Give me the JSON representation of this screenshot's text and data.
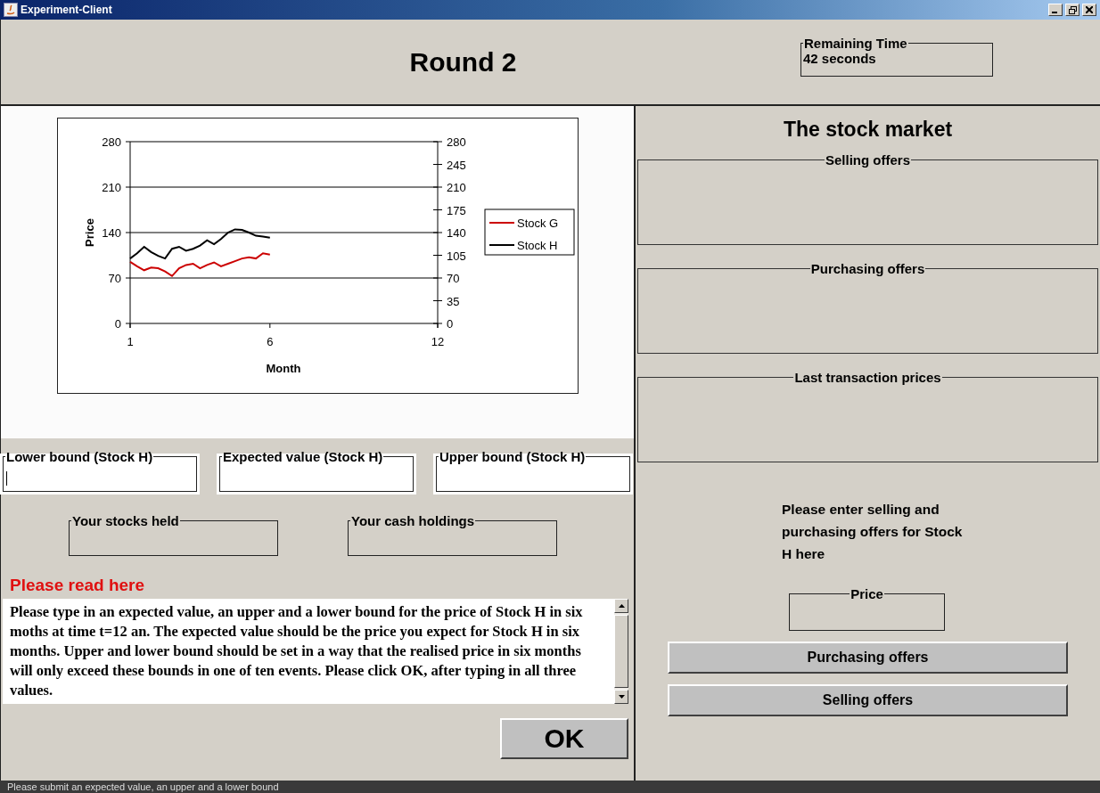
{
  "window": {
    "title": "Experiment-Client"
  },
  "header": {
    "round_title": "Round 2",
    "remaining_time": {
      "label": "Remaining Time",
      "value": "42 seconds"
    }
  },
  "chart": {
    "right_axis_ticks": [
      "280",
      "245",
      "210",
      "175",
      "140",
      "105",
      "70",
      "35",
      "0"
    ],
    "chart_data": {
      "type": "line",
      "xlabel": "Month",
      "ylabel": "Price",
      "x": [
        1,
        1.25,
        1.5,
        1.75,
        2,
        2.25,
        2.5,
        2.75,
        3,
        3.25,
        3.5,
        3.75,
        4,
        4.25,
        4.5,
        4.75,
        5,
        5.25,
        5.5,
        5.75,
        6
      ],
      "xlim": [
        1,
        12
      ],
      "ylim": [
        0,
        280
      ],
      "xticks": [
        {
          "value": 1,
          "label": "1"
        },
        {
          "value": 6,
          "label": "6"
        },
        {
          "value": 12,
          "label": "12"
        }
      ],
      "yticks": [
        {
          "value": 0,
          "label": "0"
        },
        {
          "value": 70,
          "label": "70"
        },
        {
          "value": 140,
          "label": "140"
        },
        {
          "value": 210,
          "label": "210"
        },
        {
          "value": 280,
          "label": "280"
        }
      ],
      "grid": true,
      "legend": "right",
      "series": [
        {
          "name": "Stock G",
          "color": "#cc0000",
          "values": [
            95,
            88,
            82,
            86,
            85,
            80,
            73,
            85,
            90,
            92,
            85,
            90,
            94,
            88,
            92,
            96,
            100,
            102,
            100,
            108,
            106
          ]
        },
        {
          "name": "Stock H",
          "color": "#000000",
          "values": [
            100,
            108,
            118,
            110,
            104,
            100,
            115,
            118,
            112,
            115,
            120,
            128,
            122,
            130,
            140,
            145,
            144,
            140,
            135,
            134,
            132
          ]
        }
      ]
    }
  },
  "estimate_fields": [
    {
      "label": "Lower bound (Stock H)",
      "focused": true
    },
    {
      "label": "Expected value (Stock H)",
      "focused": false
    },
    {
      "label": "Upper bound (Stock H)",
      "focused": false
    }
  ],
  "holdings": [
    {
      "label": "Your stocks held"
    },
    {
      "label": "Your cash holdings"
    }
  ],
  "instructions": {
    "heading": "Please read here",
    "text": "Please type in an expected value, an upper and a lower bound for the price of Stock H in six moths at time t=12 an. The expected value should be the price you expect for Stock H in six months. Upper and lower bound should be set in a way that the realised price in six months will only exceed these bounds in one of ten events. Please click OK, after typing in all three values."
  },
  "ok_button": "OK",
  "market": {
    "title": "The stock market",
    "lists": [
      {
        "label": "Selling offers"
      },
      {
        "label": "Purchasing offers"
      },
      {
        "label": "Last transaction prices"
      }
    ],
    "prompt": "Please enter selling and purchasing offers for Stock H here",
    "price_field": {
      "label": "Price"
    },
    "buttons": [
      "Purchasing offers",
      "Selling offers"
    ]
  },
  "status_bar": "Please submit an expected value, an upper and a lower bound"
}
